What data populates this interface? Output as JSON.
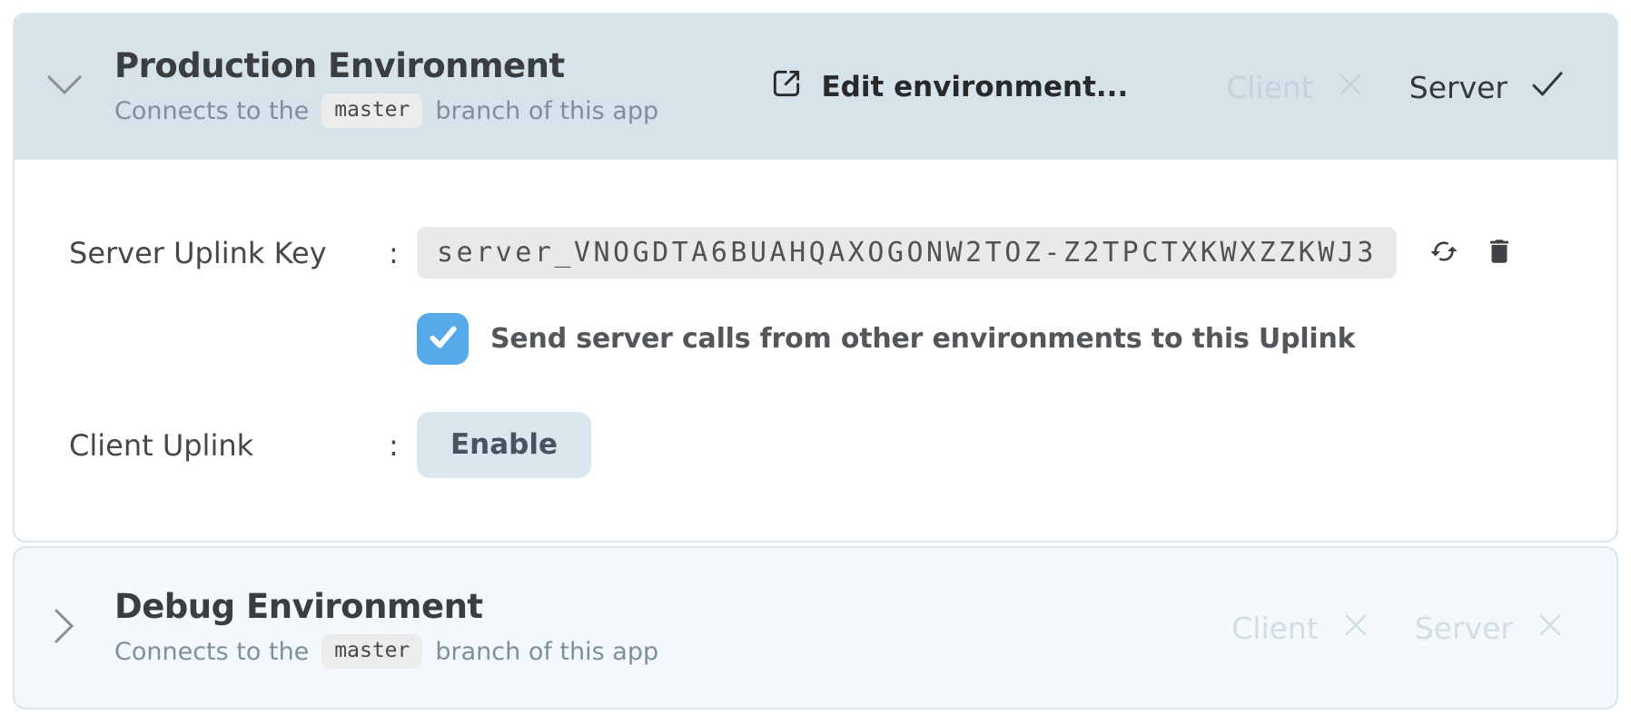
{
  "colors": {
    "header_bg": "#d7e3ea",
    "debug_panel_bg": "#f2f8fb",
    "panel_border": "#d8e5ec",
    "checkbox_accent": "#56aae9",
    "key_badge_bg": "#e9e9e9",
    "muted_toggle": "#c4d3db"
  },
  "panels": {
    "production": {
      "title": "Production Environment",
      "subtitle": {
        "prefix": "Connects to the",
        "branch": "master",
        "suffix": "branch of this app"
      },
      "actions": {
        "edit_label": "Edit environment...",
        "client": {
          "label": "Client",
          "state": "off"
        },
        "server": {
          "label": "Server",
          "state": "on"
        }
      },
      "body": {
        "server_key": {
          "label": "Server Uplink Key",
          "colon": ":",
          "value": "server_VNOGDTA6BUAHQAXOGONW2TOZ-Z2TPCTXKWXZZKWJ3",
          "checkbox_checked": true,
          "checkbox_label": "Send server calls from other environments to this Uplink"
        },
        "client_uplink": {
          "label": "Client Uplink",
          "colon": ":",
          "action_label": "Enable"
        }
      }
    },
    "debug": {
      "title": "Debug Environment",
      "subtitle": {
        "prefix": "Connects to the",
        "branch": "master",
        "suffix": "branch of this app"
      },
      "actions": {
        "client": {
          "label": "Client",
          "state": "off"
        },
        "server": {
          "label": "Server",
          "state": "off"
        }
      }
    }
  }
}
